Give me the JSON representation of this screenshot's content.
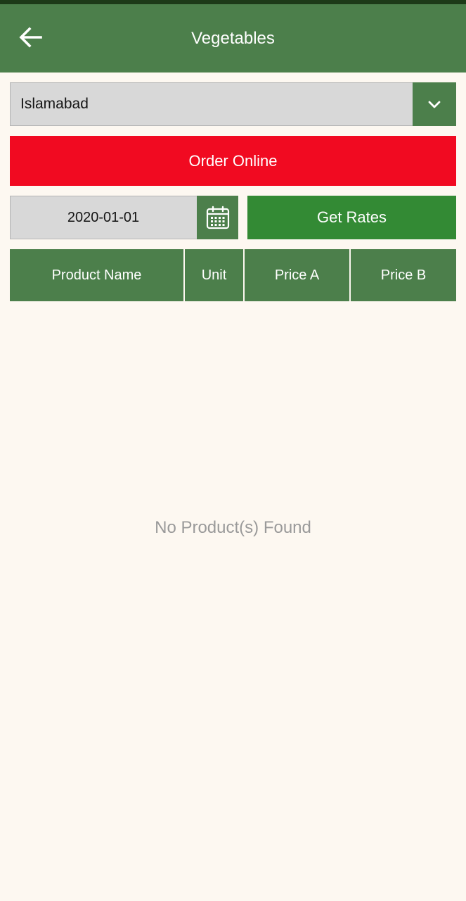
{
  "header": {
    "title": "Vegetables",
    "back_icon": "arrow-left-icon"
  },
  "city_select": {
    "value": "Islamabad",
    "icon": "chevron-down-icon"
  },
  "order_button": {
    "label": "Order Online"
  },
  "date_field": {
    "value": "2020-01-01",
    "icon": "calendar-icon"
  },
  "get_rates_button": {
    "label": "Get Rates"
  },
  "table": {
    "columns": [
      "Product Name",
      "Unit",
      "Price A",
      "Price B"
    ]
  },
  "empty_state": {
    "message": "No Product(s) Found"
  },
  "colors": {
    "primary_green": "#4c7f4b",
    "button_green": "#338a34",
    "order_red": "#f10a21",
    "background": "#fdf8f1",
    "status_bar": "#1d3a18"
  }
}
